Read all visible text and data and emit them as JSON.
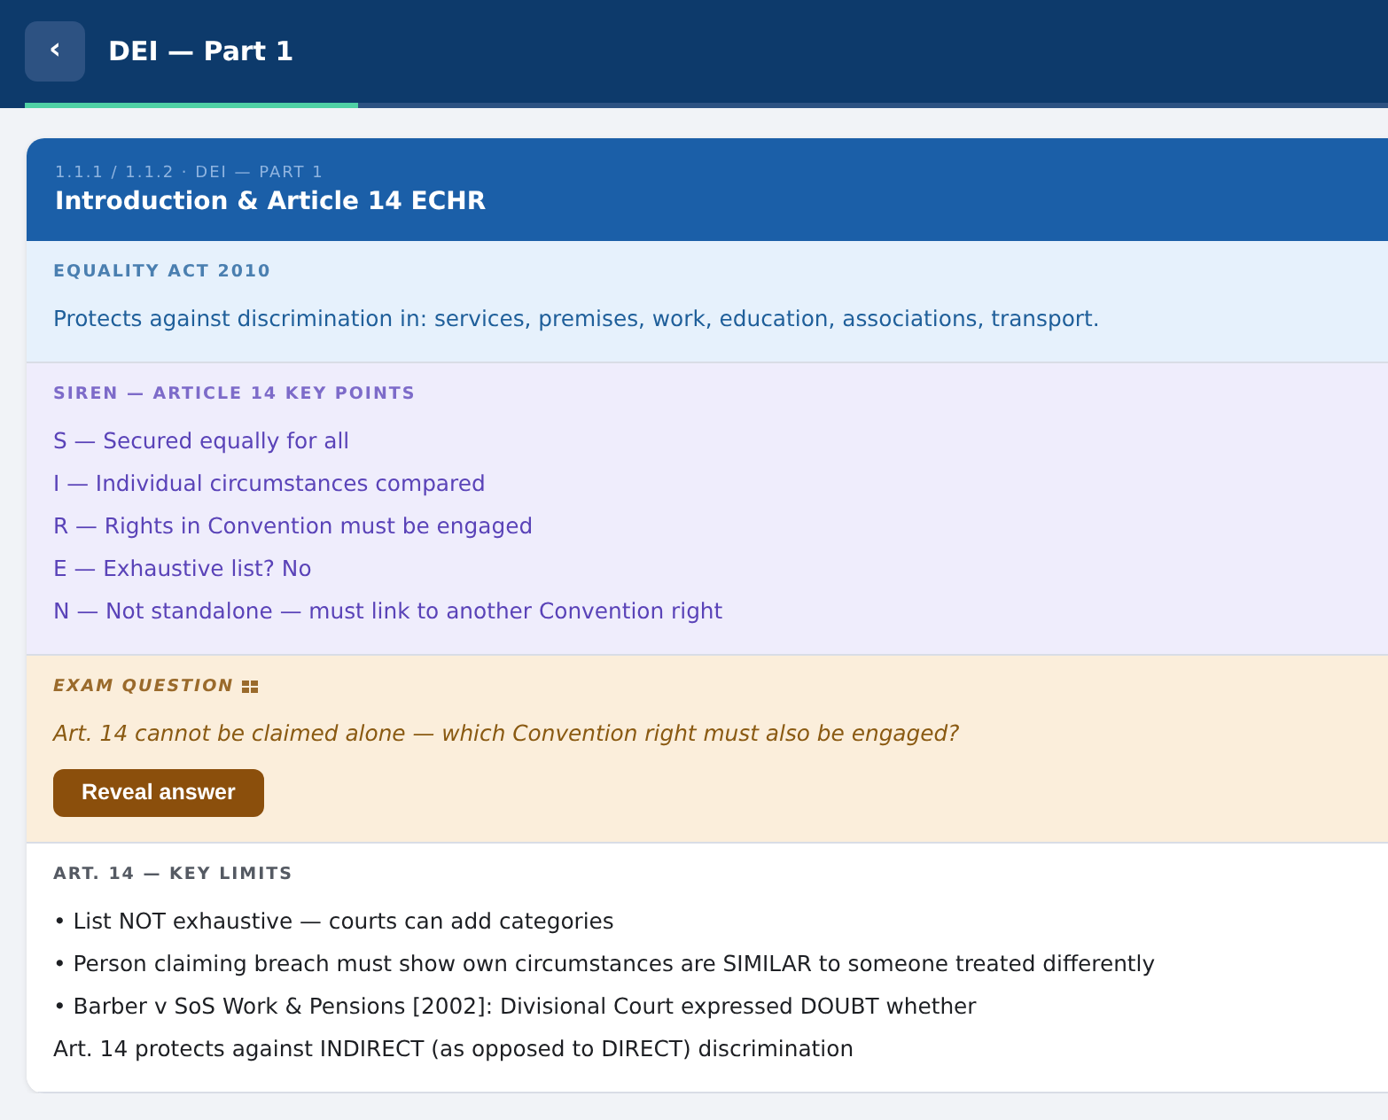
{
  "header": {
    "back_icon": "‹",
    "title": "DEI — Part 1",
    "progress": {
      "level": 0.245
    }
  },
  "card": {
    "breadcrumb": "1.1.1 / 1.1.2 · DEI — PART 1",
    "title": "Introduction & Article 14 ECHR",
    "sections": [
      {
        "kind": "info",
        "heading": "EQUALITY ACT 2010",
        "lines": [
          "Protects against discrimination in: services, premises, work, education, associations, transport."
        ]
      },
      {
        "kind": "mnemonic",
        "heading": "SIREN — ARTICLE 14 KEY POINTS",
        "lines": [
          "S — Secured equally for all",
          "I — Individual circumstances compared",
          "R — Rights in Convention must be engaged",
          "E — Exhaustive list? No",
          "N — Not standalone — must link to another Convention right"
        ]
      },
      {
        "kind": "question",
        "heading": "EXAM QUESTION",
        "lines": [
          "Art. 14 cannot be claimed alone — which Convention right must also be engaged?"
        ],
        "button": "Reveal answer"
      },
      {
        "kind": "notes",
        "heading": "ART. 14 — KEY LIMITS",
        "lines": [
          "• List NOT exhaustive — courts can add categories",
          "• Person claiming breach must show own circumstances are SIMILAR to someone treated differently",
          "• Barber v SoS Work & Pensions [2002]: Divisional Court expressed DOUBT whether",
          "Art. 14 protects against INDIRECT (as opposed to DIRECT) discrimination"
        ]
      }
    ]
  }
}
